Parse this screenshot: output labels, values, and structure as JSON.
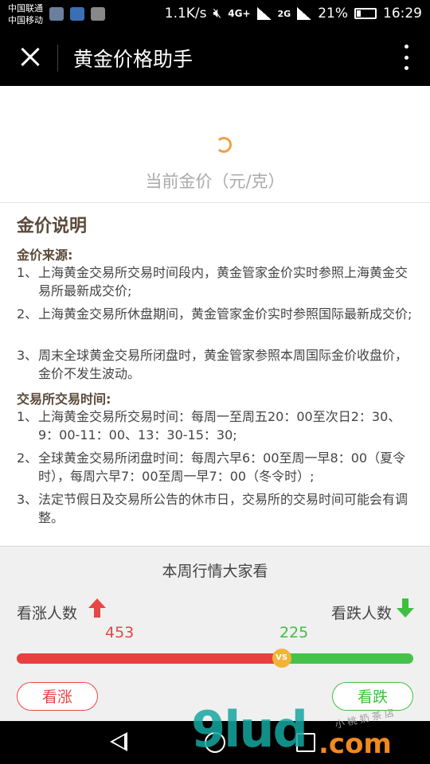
{
  "status_bar": {
    "carrier_1": "中国联通",
    "carrier_2": "中国移动",
    "speed": "1.1K/s",
    "network_1": "4G+",
    "network_2": "2G",
    "battery": "21%",
    "time": "16:29",
    "icons": [
      "weibo-icon",
      "maps-icon",
      "gallery-icon",
      "mute-icon",
      "signal-icon",
      "battery-icon"
    ]
  },
  "header": {
    "title": "黄金价格助手",
    "close_icon": "close-icon",
    "menu_icon": "more-vertical-icon"
  },
  "price": {
    "label": "当前金价（元/克）",
    "loading": true
  },
  "explanation": {
    "title": "金价说明",
    "source_heading": "金价来源:",
    "sources": [
      {
        "num": "1、",
        "text": "上海黄金交易所交易时间段内，黄金管家金价实时参照上海黄金交易所最新成交价;"
      },
      {
        "num": "2、",
        "text": "上海黄金交易所休盘期间，黄金管家金价实时参照国际最新成交价;"
      },
      {
        "num": "3、",
        "text": "周末全球黄金交易所闭盘时，黄金管家参照本周国际金价收盘价，金价不发生波动。"
      }
    ],
    "hours_heading": "交易所交易时间:",
    "hours": [
      {
        "num": "1、",
        "text": "上海黄金交易所交易时间：每周一至周五20：00至次日2：30、9：00-11：00、13：30-15：30;"
      },
      {
        "num": "2、",
        "text": "全球黄金交易所闭盘时间：每周六早6：00至周一早8：00（夏令时），每周六早7：00至周一早7：00（冬令时）;"
      },
      {
        "num": "3、",
        "text": "法定节假日及交易所公告的休市日，交易所的交易时间可能会有调整。"
      }
    ]
  },
  "vote": {
    "title": "本周行情大家看",
    "rise_label": "看涨人数",
    "fall_label": "看跌人数",
    "rise_count": "453",
    "fall_count": "225",
    "rise_fraction": 0.668,
    "vs_label": "VS",
    "rise_button": "看涨",
    "fall_button": "看跌",
    "rise_color": "#e84545",
    "fall_color": "#3fbf3f"
  },
  "nav_bar": {
    "icons": [
      "back-icon",
      "home-icon",
      "recent-apps-icon"
    ]
  },
  "watermark": {
    "main": "9lud",
    "suffix": ".com",
    "small": "小 桃 奶 茶 店"
  }
}
